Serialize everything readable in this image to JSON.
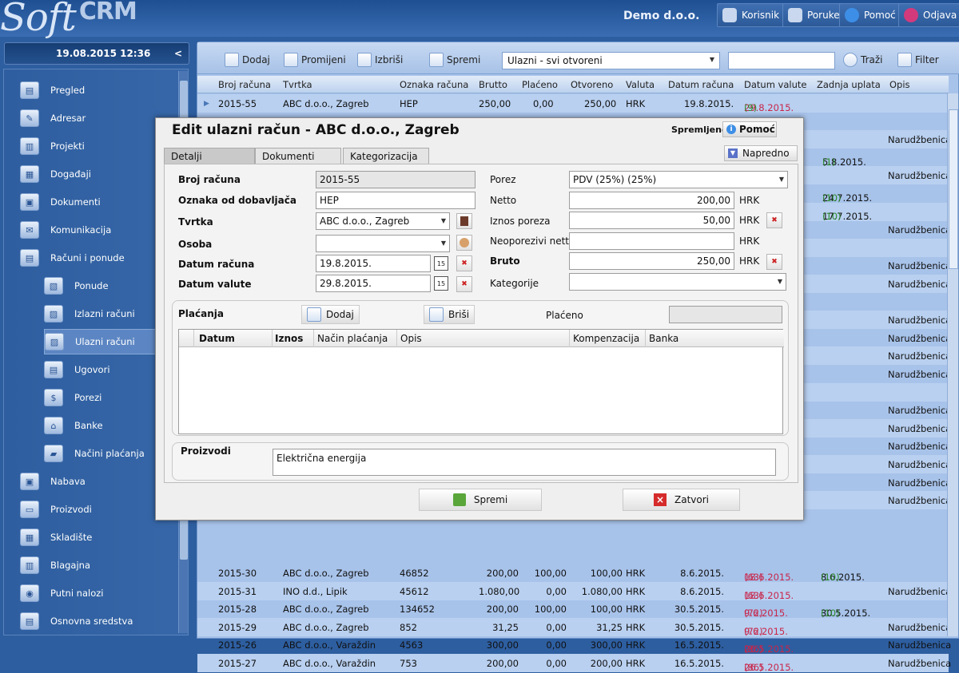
{
  "app": {
    "logo_main": "Soft",
    "logo_sub": "CRM",
    "company": "Demo d.o.o."
  },
  "topnav": [
    {
      "label": "Korisnik",
      "icon": "user-icon"
    },
    {
      "label": "Poruke",
      "icon": "message-icon"
    },
    {
      "label": "Pomoć",
      "icon": "info-icon"
    },
    {
      "label": "Odjava",
      "icon": "power-icon"
    }
  ],
  "sidebar": {
    "datetime": "19.08.2015 12:36",
    "collapse": "<",
    "items": [
      {
        "label": "Pregled",
        "icon": "overview-icon"
      },
      {
        "label": "Adresar",
        "icon": "address-book-icon"
      },
      {
        "label": "Projekti",
        "icon": "projects-icon"
      },
      {
        "label": "Događaji",
        "icon": "calendar-icon"
      },
      {
        "label": "Dokumenti",
        "icon": "documents-icon"
      },
      {
        "label": "Komunikacija",
        "icon": "communication-icon"
      },
      {
        "label": "Računi i ponude",
        "icon": "invoices-icon"
      },
      {
        "label": "Ponude",
        "icon": "offers-icon",
        "sub": true
      },
      {
        "label": "Izlazni računi",
        "icon": "outgoing-invoice-icon",
        "sub": true
      },
      {
        "label": "Ulazni računi",
        "icon": "incoming-invoice-icon",
        "sub": true,
        "selected": true
      },
      {
        "label": "Ugovori",
        "icon": "contracts-icon",
        "sub": true
      },
      {
        "label": "Porezi",
        "icon": "taxes-icon",
        "sub": true
      },
      {
        "label": "Banke",
        "icon": "bank-icon",
        "sub": true
      },
      {
        "label": "Načini plaćanja",
        "icon": "payment-methods-icon",
        "sub": true
      },
      {
        "label": "Nabava",
        "icon": "procurement-icon"
      },
      {
        "label": "Proizvodi",
        "icon": "products-icon"
      },
      {
        "label": "Skladište",
        "icon": "warehouse-icon"
      },
      {
        "label": "Blagajna",
        "icon": "cash-register-icon"
      },
      {
        "label": "Putni nalozi",
        "icon": "travel-orders-icon"
      },
      {
        "label": "Osnovna sredstva",
        "icon": "fixed-assets-icon"
      }
    ]
  },
  "toolbar": {
    "add": "Dodaj",
    "modify": "Promijeni",
    "delete": "Izbriši",
    "save": "Spremi",
    "filter_value": "Ulazni - svi otvoreni",
    "search": "Traži",
    "filter": "Filter"
  },
  "grid": {
    "columns": [
      "Broj računa",
      "Tvrtka",
      "Oznaka računa",
      "Brutto",
      "Plaćeno",
      "Otvoreno",
      "Valuta",
      "Datum računa",
      "Datum valute",
      "Zadnja uplata",
      "Opis"
    ],
    "first_row": {
      "broj": "2015-55",
      "tvrtka": "ABC d.o.o., Zagreb",
      "oznaka": "HEP",
      "brutto": "250,00",
      "placeno": "0,00",
      "otvoreno": "250,00",
      "valuta": "HRK",
      "datum": "19.8.2015.",
      "valute": "29.8.2015.",
      "valute_days": "(9)"
    },
    "right_fragments": [
      {
        "row": 2,
        "opis": "Narudžbenica"
      },
      {
        "row": 3,
        "uplata": "5.8.2015.",
        "uplata_days": "(1)"
      },
      {
        "row": 4,
        "opis": "Narudžbenica"
      },
      {
        "row": 5,
        "uplata": "24.7.2015.",
        "uplata_days": "(10)"
      },
      {
        "row": 6,
        "uplata": "17.7.2015.",
        "uplata_days": "(10)"
      },
      {
        "row": 7,
        "opis": "Narudžbenica"
      },
      {
        "row": 9,
        "opis": "Narudžbenica"
      },
      {
        "row": 10,
        "opis": "Narudžbenica"
      },
      {
        "row": 12,
        "opis": "Narudžbenica"
      },
      {
        "row": 13,
        "opis": "Narudžbenica"
      },
      {
        "row": 14,
        "opis": "Narudžbenica"
      },
      {
        "row": 15,
        "opis": "Narudžbenica"
      },
      {
        "row": 17,
        "opis": "Narudžbenica"
      },
      {
        "row": 18,
        "opis": "Narudžbenica"
      },
      {
        "row": 19,
        "opis": "Narudžbenica"
      },
      {
        "row": 20,
        "opis": "Narudžbenica"
      },
      {
        "row": 21,
        "opis": "Narudžbenica"
      },
      {
        "row": 22,
        "opis": "Narudžbenica"
      }
    ],
    "rows": [
      {
        "broj": "2015-30",
        "tvrtka": "ABC d.o.o., Zagreb",
        "oznaka": "46852",
        "brutto": "200,00",
        "placeno": "100,00",
        "otvoreno": "100,00",
        "valuta": "HRK",
        "datum": "8.6.2015.",
        "valute": "18.6.2015.",
        "valute_days": "(63)",
        "uplata": "8.6.2015.",
        "uplata_days": "(10)",
        "opis": ""
      },
      {
        "broj": "2015-31",
        "tvrtka": "INO d.d., Lipik",
        "oznaka": "45612",
        "brutto": "1.080,00",
        "placeno": "0,00",
        "otvoreno": "1.080,00",
        "valuta": "HRK",
        "datum": "8.6.2015.",
        "valute": "18.6.2015.",
        "valute_days": "(63)",
        "uplata": "",
        "uplata_days": "",
        "opis": "Narudžbenica"
      },
      {
        "broj": "2015-28",
        "tvrtka": "ABC d.o.o., Zagreb",
        "oznaka": "134652",
        "brutto": "200,00",
        "placeno": "100,00",
        "otvoreno": "100,00",
        "valuta": "HRK",
        "datum": "30.5.2015.",
        "valute": "9.6.2015.",
        "valute_days": "(72)",
        "uplata": "30.5.2015.",
        "uplata_days": "(10)",
        "opis": ""
      },
      {
        "broj": "2015-29",
        "tvrtka": "ABC d.o.o., Zagreb",
        "oznaka": "852",
        "brutto": "31,25",
        "placeno": "0,00",
        "otvoreno": "31,25",
        "valuta": "HRK",
        "datum": "30.5.2015.",
        "valute": "9.6.2015.",
        "valute_days": "(72)",
        "uplata": "",
        "uplata_days": "",
        "opis": "Narudžbenica"
      },
      {
        "broj": "2015-26",
        "tvrtka": "ABC d.o.o., Varaždin",
        "oznaka": "4563",
        "brutto": "300,00",
        "placeno": "0,00",
        "otvoreno": "300,00",
        "valuta": "HRK",
        "datum": "16.5.2015.",
        "valute": "26.5.2015.",
        "valute_days": "(86)",
        "uplata": "",
        "uplata_days": "",
        "opis": "Narudžbenica"
      },
      {
        "broj": "2015-27",
        "tvrtka": "ABC d.o.o., Varaždin",
        "oznaka": "753",
        "brutto": "200,00",
        "placeno": "0,00",
        "otvoreno": "200,00",
        "valuta": "HRK",
        "datum": "16.5.2015.",
        "valute": "26.5.2015.",
        "valute_days": "(86)",
        "uplata": "",
        "uplata_days": "",
        "opis": "Narudžbenica"
      }
    ]
  },
  "dialog": {
    "title": "Edit ulazni račun - ABC d.o.o., Zagreb",
    "saved": "Spremljeno",
    "help": "Pomoć",
    "tabs": [
      "Detalji",
      "Dokumenti",
      "Kategorizacija"
    ],
    "advanced": "Napredno",
    "form": {
      "broj_label": "Broj računa",
      "broj_value": "2015-55",
      "oznaka_label": "Oznaka od dobavljača",
      "oznaka_value": "HEP",
      "tvrtka_label": "Tvrtka",
      "tvrtka_value": "ABC d.o.o., Zagreb",
      "osoba_label": "Osoba",
      "osoba_value": "",
      "datum_label": "Datum računa",
      "datum_value": "19.8.2015.",
      "valute_label": "Datum valute",
      "valute_value": "29.8.2015.",
      "porez_label": "Porez",
      "porez_value": "PDV (25%) (25%)",
      "netto_label": "Netto",
      "netto_value": "200,00",
      "iznos_label": "Iznos poreza",
      "iznos_value": "50,00",
      "neopor_label": "Neoporezivi netto",
      "neopor_value": "",
      "bruto_label": "Bruto",
      "bruto_value": "250,00",
      "kat_label": "Kategorije",
      "kat_value": "",
      "currency": "HRK",
      "cal_day": "15"
    },
    "payments": {
      "title": "Plaćanja",
      "add": "Dodaj",
      "delete": "Briši",
      "paid_label": "Plaćeno",
      "paid_value": "",
      "columns": [
        "Datum",
        "Iznos",
        "Način plaćanja",
        "Opis",
        "Kompenzacija",
        "Banka"
      ]
    },
    "products": {
      "label": "Proizvodi",
      "value": "Električna energija"
    },
    "save": "Spremi",
    "close": "Zatvori"
  }
}
